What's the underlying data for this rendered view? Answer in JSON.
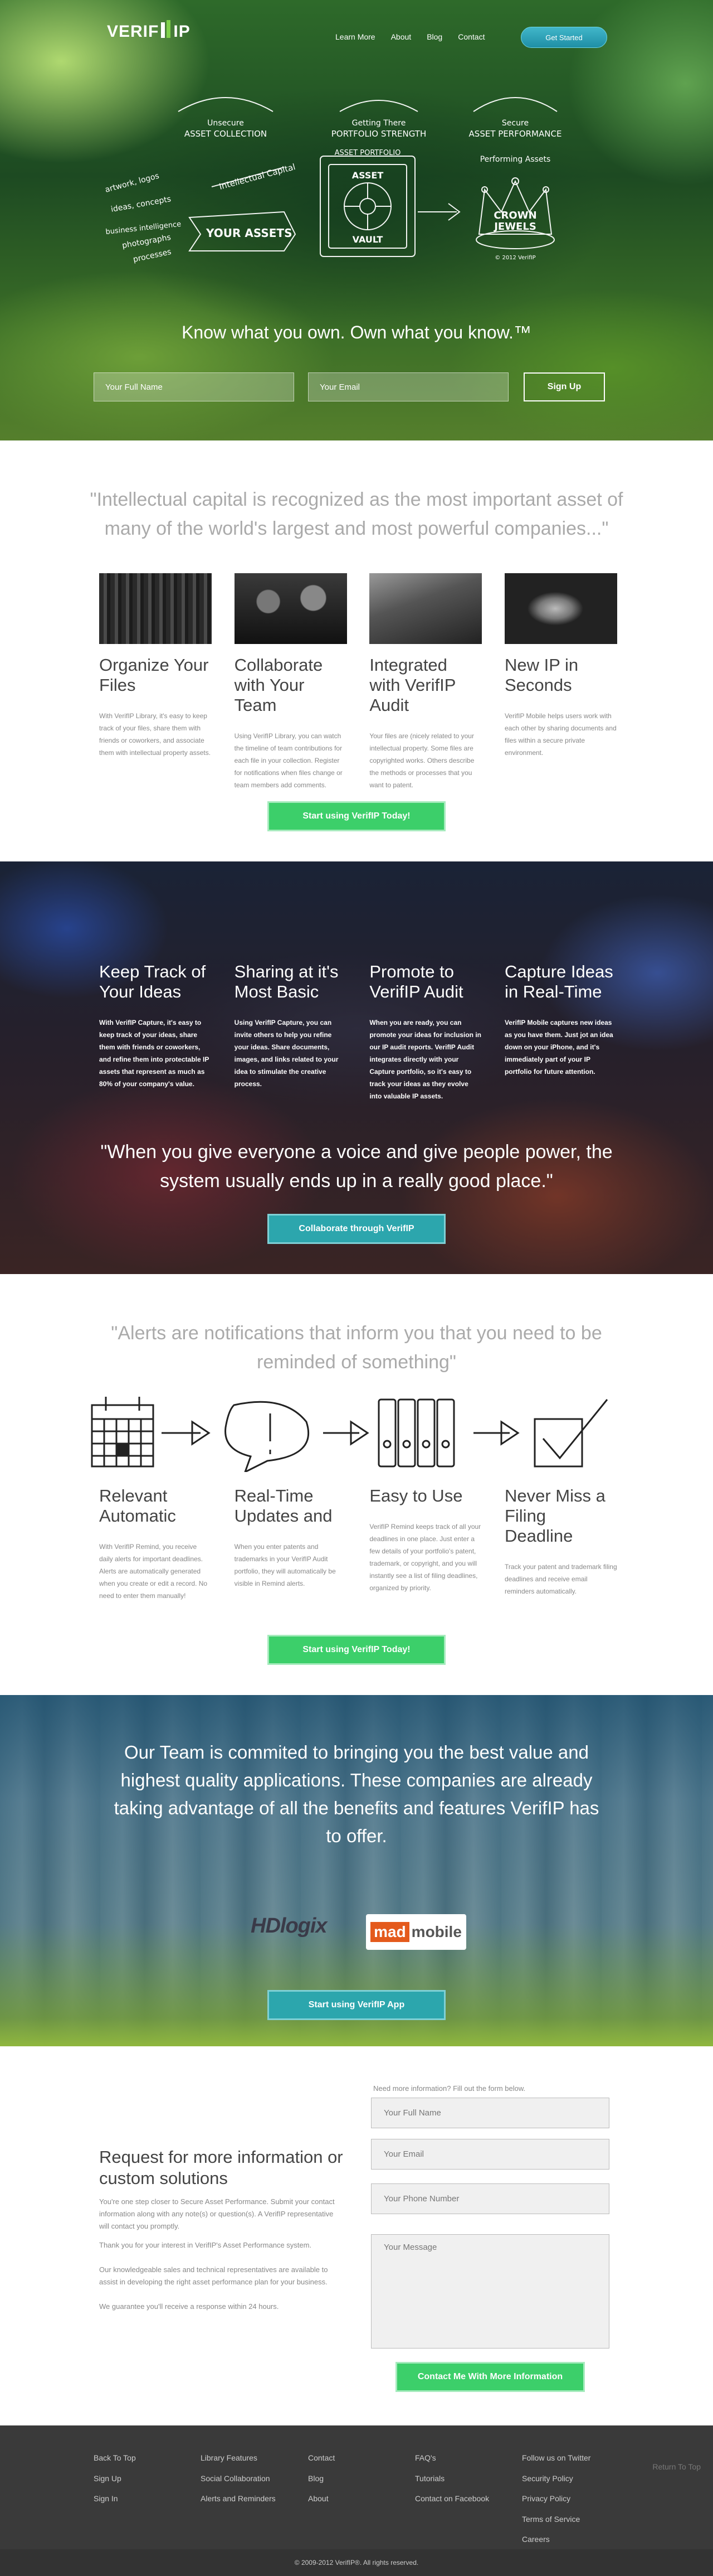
{
  "colors": {
    "green_button": "#3ccf6a",
    "teal_button": "#2ca6ad",
    "hero_cta": "#2aa3b9",
    "footer_bg": "#3a3a3a"
  },
  "header": {
    "logo": {
      "left": "VERIF",
      "right": "IP"
    },
    "nav": [
      "Learn More",
      "About",
      "Blog",
      "Contact"
    ],
    "cta": "Get Started"
  },
  "hero": {
    "chalk": {
      "unsecure_top": "Unsecure",
      "unsecure_bottom": "ASSET COLLECTION",
      "getting_top": "Getting There",
      "getting_bottom": "PORTFOLIO STRENGTH",
      "secure_top": "Secure",
      "secure_bottom": "ASSET PERFORMANCE",
      "left_items": [
        "artwork, logos",
        "ideas, concepts",
        "business intelligence",
        "photographs",
        "processes"
      ],
      "your_assets": "YOUR ASSETS",
      "intellectual_capital": "Intellectual Capital",
      "asset_portfolio": "ASSET PORTFOLIO",
      "vault_top": "ASSET",
      "vault_bottom": "VAULT",
      "performing": "Performing Assets",
      "crown_top": "CROWN",
      "crown_bottom": "JEWELS",
      "copyright": "© 2012 VerifIP"
    },
    "tagline": "Know what you own. Own what you know.™",
    "name_placeholder": "Your Full Name",
    "email_placeholder": "Your Email",
    "signup": "Sign Up"
  },
  "features": {
    "quote": "\"Intellectual capital is recognized as the most important asset of many of the world's largest and most powerful companies...\"",
    "items": [
      {
        "title": "Organize Your Files",
        "text": "With VerifIP Library, it's easy to keep track of your files, share them with friends or coworkers, and associate them with intellectual property assets."
      },
      {
        "title": "Collaborate with Your Team",
        "text": "Using VerifIP Library, you can watch the timeline of team contributions for each file in your collection. Register for notifications when files change or team members add comments."
      },
      {
        "title": "Integrated with VerifIP Audit",
        "text": "Your files are (nicely related to your intellectual property. Some files are copyrighted works. Others describe the methods or processes that you want to patent."
      },
      {
        "title": "New IP in Seconds",
        "text": "VerifIP Mobile helps users work with each other by sharing documents and files within a secure private environment."
      }
    ],
    "cta": "Start using VerifIP Today!"
  },
  "capture": {
    "items": [
      {
        "title": "Keep Track of Your Ideas",
        "text": "With VerifIP Capture, it's easy to keep track of your ideas, share them with friends or coworkers, and refine them into protectable IP assets that represent as much as 80% of your company's value."
      },
      {
        "title": "Sharing at it's Most Basic",
        "text": "Using VerifIP Capture, you can invite others to help you refine your ideas. Share documents, images, and links related to your idea to stimulate the creative process."
      },
      {
        "title": "Promote to VerifIP Audit",
        "text": "When you are ready, you can promote your ideas for inclusion in our IP audit reports. VerifIP Audit integrates directly with your Capture portfolio, so it's easy to track your ideas as they evolve into valuable IP assets."
      },
      {
        "title": "Capture Ideas in Real-Time",
        "text": "VerifIP Mobile captures new ideas as you have them. Just jot an idea down on your iPhone, and it's immediately part of your IP portfolio for future attention."
      }
    ],
    "quote": "\"When you give everyone a voice and give people power, the system usually ends up in a really good place.\"",
    "cta": "Collaborate through VerifIP"
  },
  "alerts": {
    "quote": "\"Alerts are notifications that inform you that you need to be reminded of something\"",
    "items": [
      {
        "title": "Relevant Automatic",
        "text": "With VerifIP Remind, you receive daily alerts for important deadlines. Alerts are automatically generated when you create or edit a record. No need to enter them manually!"
      },
      {
        "title": "Real-Time Updates and",
        "text": "When you enter patents and trademarks in your VerifIP Audit portfolio, they will automatically be visible in Remind alerts."
      },
      {
        "title": "Easy to Use",
        "text": "VerifIP Remind keeps track of all your deadlines in one place. Just enter a few details of your portfolio's patent, trademark, or copyright, and you will instantly see a list of filing deadlines, organized by priority."
      },
      {
        "title": "Never Miss a Filing Deadline",
        "text": "Track your patent and trademark filing deadlines and receive email reminders automatically."
      }
    ],
    "cta": "Start using VerifIP Today!"
  },
  "team": {
    "text": "Our Team is commited to bringing you the best value and highest quality applications. These companies are already taking advantage of all the benefits and features VerifIP has to offer.",
    "logo1": "HDlogix",
    "logo2_a": "mad",
    "logo2_b": "mobile",
    "cta": "Start using VerifIP App"
  },
  "contact": {
    "title": "Request for more information or custom solutions",
    "paragraphs": [
      "You're one step closer to Secure Asset Performance. Submit your contact information along with any note(s) or question(s). A VerifIP representative will contact you promptly.",
      "Thank you for your interest in VerifIP's Asset Performance system.",
      "Our knowledgeable sales and technical representatives are available to assist in developing the right asset performance plan for your business.",
      "We guarantee you'll receive a response within 24 hours."
    ],
    "form_intro": "Need more information? Fill out the form below.",
    "name_placeholder": "Your Full Name",
    "email_placeholder": "Your Email",
    "phone_placeholder": "Your Phone Number",
    "message_placeholder": "Your Message",
    "submit": "Contact Me With More Information"
  },
  "footer": {
    "col1": [
      "Back To Top",
      "Sign Up",
      "Sign In"
    ],
    "col2": [
      "Library Features",
      "Social Collaboration",
      "Alerts and Reminders"
    ],
    "col3": [
      "Contact",
      "Blog",
      "About"
    ],
    "col4": [
      "FAQ's",
      "Tutorials",
      "Contact on Facebook"
    ],
    "col5": [
      "Follow us on Twitter",
      "Security Policy",
      "Privacy Policy",
      "Terms of Service",
      "Careers"
    ],
    "back_to_top_right": "Return To Top",
    "copyright": "© 2009-2012 VerifIP®. All rights reserved."
  }
}
